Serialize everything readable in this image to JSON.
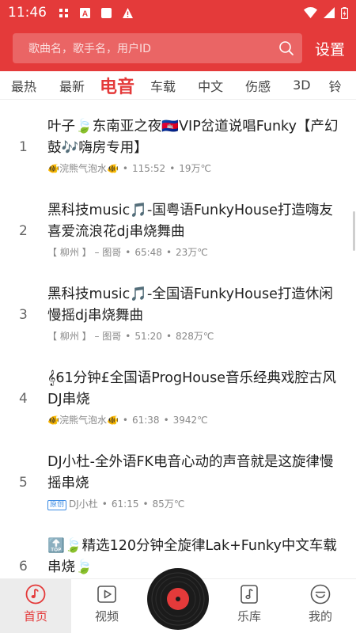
{
  "status_bar": {
    "time": "11:46"
  },
  "header": {
    "search_placeholder": "歌曲名，歌手名，用户ID",
    "settings_label": "设置"
  },
  "tabs": [
    {
      "label": "最热"
    },
    {
      "label": "最新"
    },
    {
      "label": "电音"
    },
    {
      "label": "车载"
    },
    {
      "label": "中文"
    },
    {
      "label": "伤感"
    },
    {
      "label": "3D"
    },
    {
      "label": "铃"
    }
  ],
  "songs": [
    {
      "index": "1",
      "title": "叶子🍃东南亚之夜🇰🇭VIP岔道说唱Funky【产幻鼓🎶嗨房专用】",
      "author": "🐠浣熊气泡水🐠",
      "duration": "115:52",
      "plays": "19万℃"
    },
    {
      "index": "2",
      "title": "黑科技music🎵-国粤语FunkyHouse打造嗨友喜爱流浪花dj串烧舞曲",
      "author": "【 柳州 】 – 图哥",
      "duration": "65:48",
      "plays": "23万℃"
    },
    {
      "index": "3",
      "title": "黑科技music🎵-全国语FunkyHouse打造休闲慢摇dj串烧舞曲",
      "author": "【 柳州 】 – 图哥",
      "duration": "51:20",
      "plays": "828万℃"
    },
    {
      "index": "4",
      "title": "𝄞61分钟£全国语ProgHouse音乐经典戏腔古风DJ串烧",
      "author": "🐠浣熊气泡水🐠",
      "duration": "61:38",
      "plays": "3942℃"
    },
    {
      "index": "5",
      "title": "DJ小杜-全外语FK电音心动的声音就是这旋律慢摇串烧",
      "badge": "原创",
      "author": "DJ小杜",
      "duration": "61:15",
      "plays": "85万℃"
    },
    {
      "index": "6",
      "title": "🔝🍃精选120分钟全旋律Lak+Funky中文车载串烧🍃",
      "author": "",
      "duration": "",
      "plays": ""
    }
  ],
  "bottom_nav": [
    {
      "label": "首页"
    },
    {
      "label": "视频"
    },
    {
      "label": "乐库"
    },
    {
      "label": "我的"
    }
  ],
  "colors": {
    "brand": "#e43a3a",
    "badge": "#3a8ae4"
  }
}
